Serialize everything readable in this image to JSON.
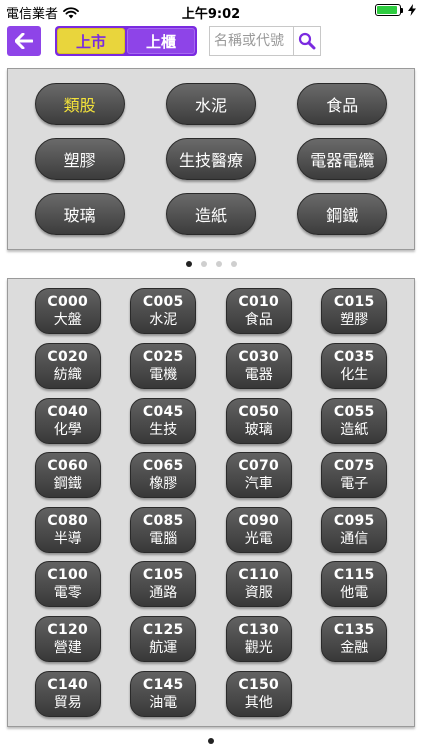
{
  "status_bar": {
    "carrier": "電信業者",
    "time": "上午9:02",
    "battery_level": 0.9
  },
  "toolbar": {
    "back_icon": "back-arrow-icon",
    "segments": [
      {
        "label": "上市",
        "active": true
      },
      {
        "label": "上櫃",
        "active": false
      }
    ],
    "search_placeholder": "名稱或代號",
    "search_icon": "search-icon"
  },
  "colors": {
    "accent_purple": "#8e44e8",
    "active_yellow": "#e9d53c",
    "panel_gray": "#dcdcdc"
  },
  "categories": [
    {
      "label": "類股",
      "active": true
    },
    {
      "label": "水泥"
    },
    {
      "label": "食品"
    },
    {
      "label": "塑膠"
    },
    {
      "label": "生技醫療"
    },
    {
      "label": "電器電纜"
    },
    {
      "label": "玻璃"
    },
    {
      "label": "造紙"
    },
    {
      "label": "鋼鐵"
    }
  ],
  "category_pager": {
    "pages": 4,
    "current": 1
  },
  "indices": [
    {
      "code": "C000",
      "name": "大盤"
    },
    {
      "code": "C005",
      "name": "水泥"
    },
    {
      "code": "C010",
      "name": "食品"
    },
    {
      "code": "C015",
      "name": "塑膠"
    },
    {
      "code": "C020",
      "name": "紡織"
    },
    {
      "code": "C025",
      "name": "電機"
    },
    {
      "code": "C030",
      "name": "電器"
    },
    {
      "code": "C035",
      "name": "化生"
    },
    {
      "code": "C040",
      "name": "化學"
    },
    {
      "code": "C045",
      "name": "生技"
    },
    {
      "code": "C050",
      "name": "玻璃"
    },
    {
      "code": "C055",
      "name": "造紙"
    },
    {
      "code": "C060",
      "name": "鋼鐵"
    },
    {
      "code": "C065",
      "name": "橡膠"
    },
    {
      "code": "C070",
      "name": "汽車"
    },
    {
      "code": "C075",
      "name": "電子"
    },
    {
      "code": "C080",
      "name": "半導"
    },
    {
      "code": "C085",
      "name": "電腦"
    },
    {
      "code": "C090",
      "name": "光電"
    },
    {
      "code": "C095",
      "name": "通信"
    },
    {
      "code": "C100",
      "name": "電零"
    },
    {
      "code": "C105",
      "name": "通路"
    },
    {
      "code": "C110",
      "name": "資服"
    },
    {
      "code": "C115",
      "name": "他電"
    },
    {
      "code": "C120",
      "name": "營建"
    },
    {
      "code": "C125",
      "name": "航運"
    },
    {
      "code": "C130",
      "name": "觀光"
    },
    {
      "code": "C135",
      "name": "金融"
    },
    {
      "code": "C140",
      "name": "貿易"
    },
    {
      "code": "C145",
      "name": "油電"
    },
    {
      "code": "C150",
      "name": "其他"
    }
  ],
  "index_pager": {
    "pages": 1,
    "current": 1
  }
}
